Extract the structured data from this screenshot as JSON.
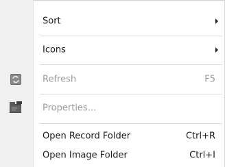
{
  "menu": {
    "items": [
      {
        "label": "Sort",
        "shortcut": "",
        "submenu": true,
        "disabled": false,
        "icon": ""
      },
      {
        "label": "Icons",
        "shortcut": "",
        "submenu": true,
        "disabled": false,
        "icon": ""
      },
      {
        "label": "Refresh",
        "shortcut": "F5",
        "submenu": false,
        "disabled": true,
        "icon": "refresh-icon"
      },
      {
        "label": "Properties...",
        "shortcut": "",
        "submenu": false,
        "disabled": true,
        "icon": "properties-icon"
      },
      {
        "label": "Open Record Folder",
        "shortcut": "Ctrl+R",
        "submenu": false,
        "disabled": false,
        "icon": ""
      },
      {
        "label": "Open Image Folder",
        "shortcut": "Ctrl+I",
        "submenu": false,
        "disabled": false,
        "icon": ""
      }
    ]
  },
  "colors": {
    "gutter": "#f0f0f0",
    "text": "#1a1a1a",
    "disabled_text": "#9a9a9a",
    "separator": "#dadada"
  }
}
